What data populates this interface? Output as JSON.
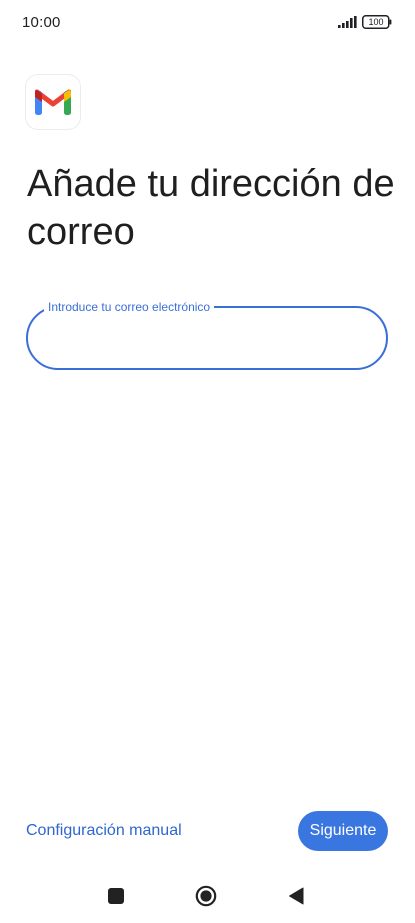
{
  "status_bar": {
    "time": "10:00",
    "battery": "100",
    "icons": [
      "signal-icon",
      "battery-icon"
    ]
  },
  "logo": {
    "icon": "gmail-logo-icon",
    "colors": {
      "red": "#ea4335",
      "blue": "#4285f4",
      "green": "#34a853",
      "yellow": "#fbbc04",
      "dark_red": "#c5221f"
    }
  },
  "page": {
    "title": "Añade tu dirección de correo"
  },
  "email_field": {
    "label": "Introduce tu correo electrónico",
    "value": "",
    "placeholder": ""
  },
  "footer": {
    "manual_link": "Configuración manual",
    "next_button": "Siguiente"
  },
  "nav_bar": {
    "icons": [
      "recents-icon",
      "home-icon",
      "back-icon"
    ]
  },
  "colors": {
    "accent": "#3a6fd8",
    "button": "#3a76e0",
    "link": "#2f66cf"
  }
}
